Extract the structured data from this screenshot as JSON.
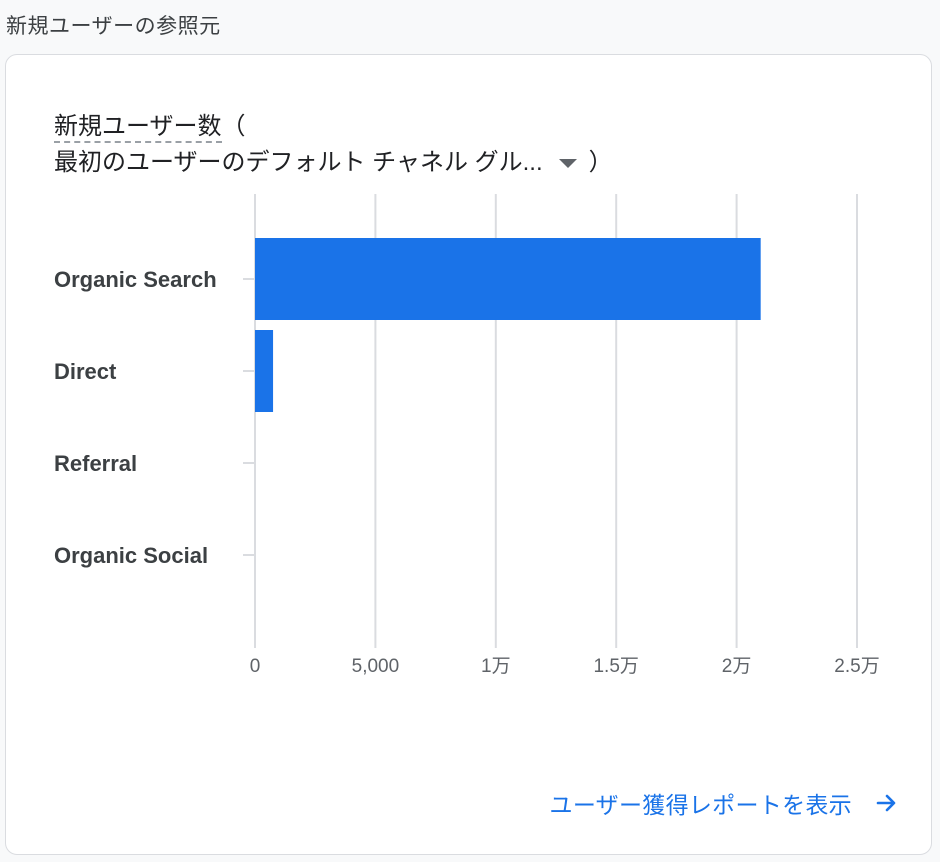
{
  "section_title": "新規ユーザーの参照元",
  "card": {
    "metric_name": "新規ユーザー数",
    "metric_open_paren": "（",
    "dimension_label": "最初のユーザーのデフォルト チャネル グル...",
    "dimension_close_paren": "）",
    "dropdown_icon": "caret-down-icon",
    "footer_link_label": "ユーザー獲得レポートを表示",
    "footer_link_icon": "arrow-right-icon"
  },
  "colors": {
    "bar": "#1a73e8",
    "link": "#1a73e8",
    "grid": "#dadce0"
  },
  "chart_data": {
    "type": "bar",
    "orientation": "horizontal",
    "title": "新規ユーザー数（最初のユーザーのデフォルト チャネル グループ）",
    "categories": [
      "Organic Search",
      "Direct",
      "Referral",
      "Organic Social"
    ],
    "values": [
      21000,
      750,
      0,
      0
    ],
    "xlabel": "",
    "ylabel": "",
    "xlim": [
      0,
      25000
    ],
    "x_ticks": [
      0,
      5000,
      10000,
      15000,
      20000,
      25000
    ],
    "x_tick_labels": [
      "0",
      "5,000",
      "1万",
      "1.5万",
      "2万",
      "2.5万"
    ],
    "grid": true,
    "legend": "none"
  }
}
